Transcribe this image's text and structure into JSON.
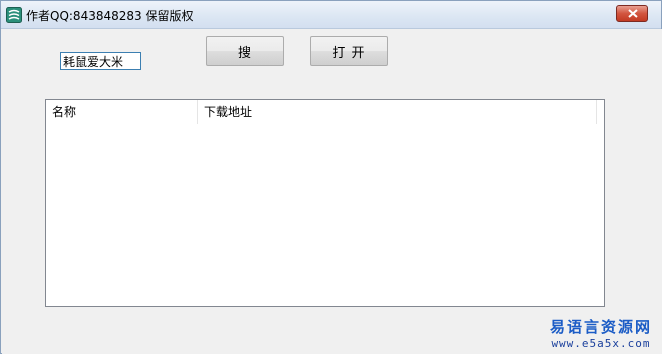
{
  "window": {
    "title": "作者QQ:843848283 保留版权",
    "icon": "app-icon",
    "close_icon": "close-icon"
  },
  "search": {
    "value": "耗鼠爱大米",
    "placeholder": ""
  },
  "buttons": {
    "search_label": "搜",
    "open_label": "打 开"
  },
  "list": {
    "columns": [
      "名称",
      "下载地址"
    ],
    "rows": []
  },
  "watermark": {
    "text": "易语言资源网",
    "url": "www.e5a5x.com"
  },
  "colors": {
    "accent": "#3c7fb1",
    "close_button": "#c23a23",
    "watermark": "#1b5cc6"
  }
}
